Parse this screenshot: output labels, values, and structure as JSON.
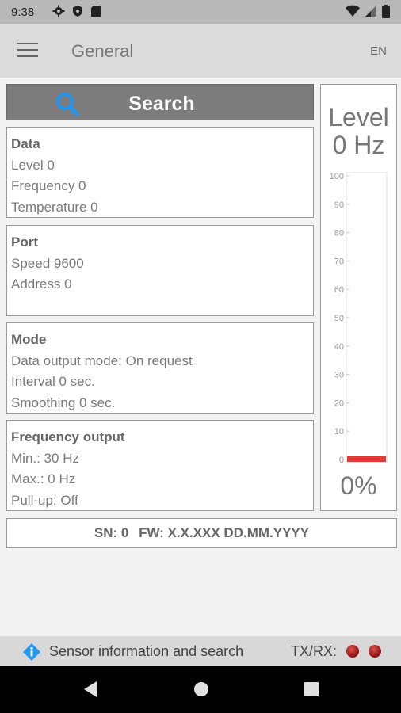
{
  "status_bar": {
    "time": "9:38",
    "icons": [
      "settings-icon",
      "shield-icon",
      "sd-card-icon"
    ],
    "system_icons": [
      "wifi-icon",
      "signal-icon",
      "battery-icon"
    ]
  },
  "app_bar": {
    "title": "General",
    "language": "EN"
  },
  "search": {
    "label": "Search",
    "icon": "search-icon",
    "icon_color": "#2196f3"
  },
  "cards": {
    "data": {
      "heading": "Data",
      "lines": [
        "Level 0",
        "Frequency 0",
        "Temperature 0"
      ]
    },
    "port": {
      "heading": "Port",
      "lines": [
        "Speed 9600",
        "Address 0"
      ]
    },
    "mode": {
      "heading": "Mode",
      "lines": [
        "Data output mode: On request",
        "Interval 0 sec.",
        "Smoothing 0 sec."
      ]
    },
    "frequency_output": {
      "heading": "Frequency output",
      "lines": [
        "Min.: 30 Hz",
        "Max.: 0 Hz",
        "Pull-up: Off"
      ]
    }
  },
  "gauge": {
    "title": "Level",
    "value_text": "0 Hz",
    "percent_text": "0%",
    "level_fraction": 0,
    "bar_color": "#e53935",
    "ticks": [
      "100",
      "90",
      "80",
      "70",
      "60",
      "50",
      "40",
      "30",
      "20",
      "10",
      "0"
    ]
  },
  "device_info": {
    "sn": "SN: 0",
    "fw": "FW: X.X.XXX DD.MM.YYYY"
  },
  "footer": {
    "info_text": "Sensor information and search",
    "txrx_label": "TX/RX:",
    "led_color": "#c62828"
  },
  "nav_bar": {
    "icons": [
      "back-icon",
      "home-icon",
      "recents-icon"
    ]
  }
}
